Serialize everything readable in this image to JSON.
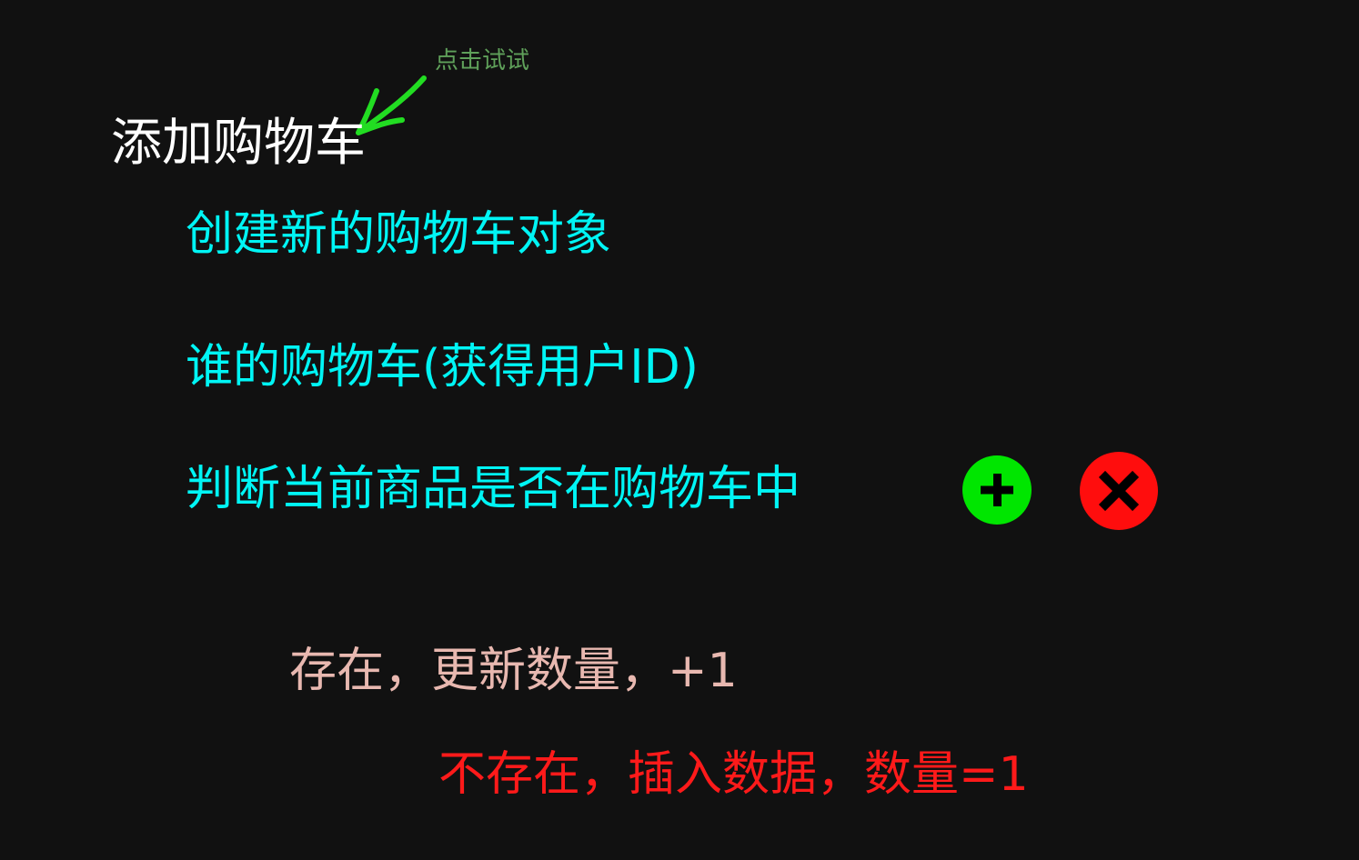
{
  "title": "添加购物车",
  "hint": "点击试试",
  "steps": [
    "创建新的购物车对象",
    "谁的购物车(获得用户ID)",
    "判断当前商品是否在购物车中"
  ],
  "branches": {
    "exists": "存在，更新数量，+1",
    "not_exists": "不存在，插入数据，数量=1"
  },
  "icons": {
    "arrow": "hand-drawn-arrow-icon",
    "plus": "plus-circle-icon",
    "close": "close-circle-icon"
  },
  "colors": {
    "background": "#111111",
    "title": "#ffffff",
    "hint": "#5fa05a",
    "arrow": "#22dd22",
    "steps": "#00f5f5",
    "exists": "#e8b8b0",
    "not_exists": "#ff1a1a",
    "plus_button": "#00e600",
    "close_button": "#ff0d0d"
  }
}
